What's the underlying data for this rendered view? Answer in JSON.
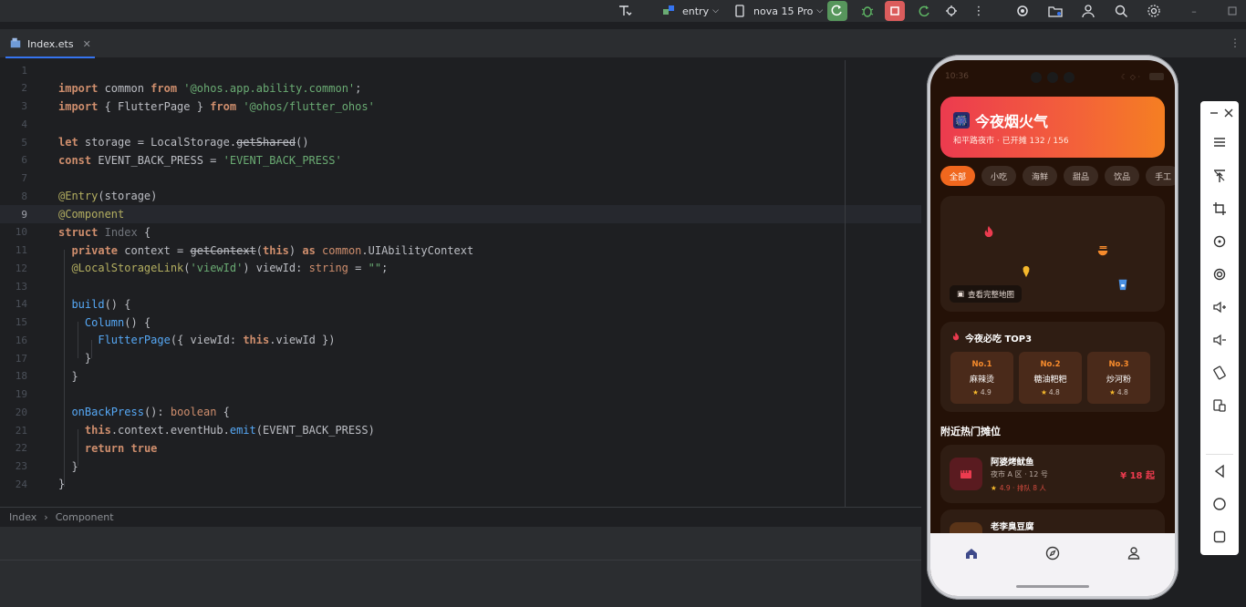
{
  "toolbar": {
    "run_config": "entry",
    "device": "nova 15 Pro"
  },
  "editor": {
    "tab_label": "Index.ets",
    "breadcrumb": [
      "Index",
      "Component"
    ],
    "active_line": 9,
    "line_numbers": [
      "1",
      "2",
      "3",
      "4",
      "5",
      "6",
      "7",
      "8",
      "9",
      "10",
      "11",
      "12",
      "13",
      "14",
      "15",
      "16",
      "17",
      "18",
      "19",
      "20",
      "21",
      "22",
      "23",
      "24"
    ]
  },
  "app": {
    "status_time": "10:36",
    "hero_title": "今夜烟火气",
    "hero_emoji": "🎆",
    "hero_subtitle": "和平路夜市 · 已开摊 132 / 156",
    "chips": [
      "全部",
      "小吃",
      "海鲜",
      "甜品",
      "饮品",
      "手工"
    ],
    "map_button": "查看完整地图",
    "top3_title": "今夜必吃 TOP3",
    "top3": [
      {
        "no": "No.1",
        "name": "麻辣烫",
        "score": "4.9"
      },
      {
        "no": "No.2",
        "name": "糖油粑粑",
        "score": "4.8"
      },
      {
        "no": "No.3",
        "name": "炒河粉",
        "score": "4.8"
      }
    ],
    "nearby_title": "附近热门摊位",
    "stalls": [
      {
        "name": "阿婆烤鱿鱼",
        "location": "夜市 A 区 · 12 号",
        "meta": "4.9 · 排队 8 人",
        "price": "¥ 18 起"
      },
      {
        "name": "老李臭豆腐",
        "location": "",
        "meta": "",
        "price": ""
      }
    ]
  }
}
